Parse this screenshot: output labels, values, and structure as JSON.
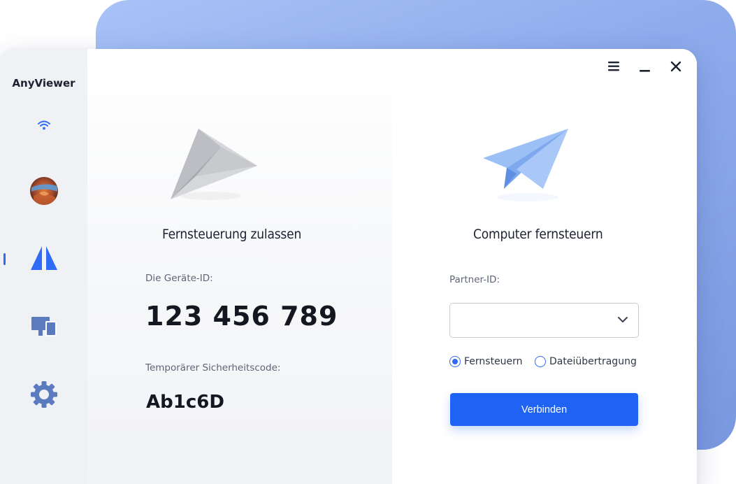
{
  "app": {
    "name": "AnyViewer"
  },
  "sidebar": {
    "items": [
      {
        "id": "connection",
        "icon": "wifi-icon"
      },
      {
        "id": "account",
        "icon": "avatar-icon"
      },
      {
        "id": "remote",
        "icon": "anyviewer-logo-icon",
        "active": true
      },
      {
        "id": "devices",
        "icon": "devices-icon"
      },
      {
        "id": "settings",
        "icon": "gear-icon"
      }
    ]
  },
  "window_controls": {
    "menu_icon": "hamburger-menu-icon",
    "minimize_icon": "minimize-icon",
    "close_icon": "close-icon"
  },
  "allow_panel": {
    "title": "Fernsteuerung zulassen",
    "device_id_label": "Die Geräte-ID:",
    "device_id": "123 456 789",
    "security_code_label": "Temporärer Sicherheitscode:",
    "security_code": "Ab1c6D"
  },
  "control_panel": {
    "title": "Computer fernsteuern",
    "partner_id_label": "Partner-ID:",
    "partner_id_value": "",
    "partner_id_placeholder": "",
    "modes": [
      {
        "label": "Fernsteuern",
        "selected": true
      },
      {
        "label": "Dateiübertragung",
        "selected": false
      }
    ],
    "connect_button": "Verbinden"
  },
  "colors": {
    "accent": "#1f63f5",
    "sidebar_bg": "#f0f1f5",
    "icon_blue": "#2f6bf5",
    "icon_slate": "#5c7bbf",
    "backdrop": "#8eabec"
  }
}
